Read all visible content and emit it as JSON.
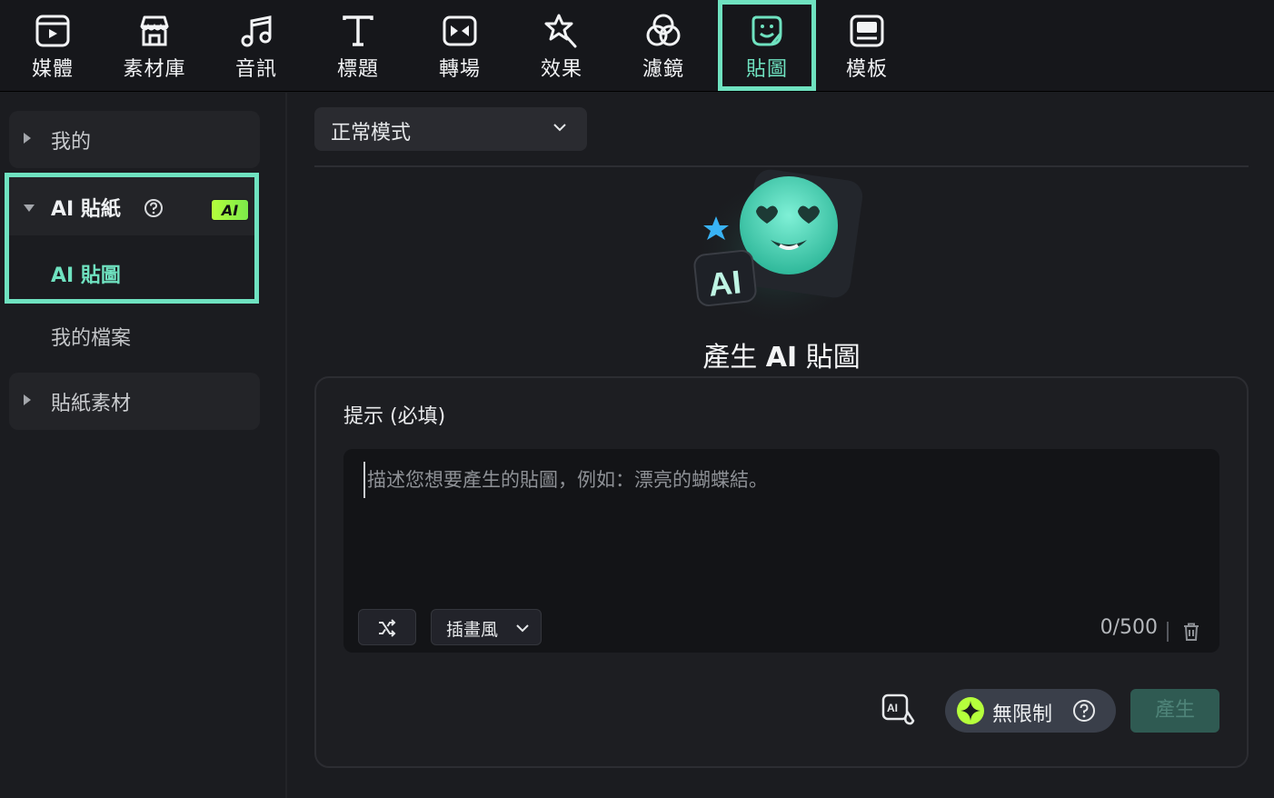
{
  "colors": {
    "accent": "#6fe2c0",
    "ai_badge": "#b5ff3c",
    "background": "#1b1c20"
  },
  "toolbar": {
    "tabs": [
      {
        "label": "媒體",
        "icon": "media-icon"
      },
      {
        "label": "素材庫",
        "icon": "store-icon"
      },
      {
        "label": "音訊",
        "icon": "music-note-icon"
      },
      {
        "label": "標題",
        "icon": "title-t-icon"
      },
      {
        "label": "轉場",
        "icon": "transition-icon"
      },
      {
        "label": "效果",
        "icon": "effects-star-icon"
      },
      {
        "label": "濾鏡",
        "icon": "filter-circles-icon"
      },
      {
        "label": "貼圖",
        "icon": "sticker-icon",
        "active": true
      },
      {
        "label": "模板",
        "icon": "template-icon"
      }
    ]
  },
  "sidebar": {
    "mine": "我的",
    "ai_sticker_group": "AI 貼紙",
    "ai_badge": "AI",
    "ai_sticker_item": "AI 貼圖",
    "my_files": "我的檔案",
    "sticker_assets": "貼紙素材"
  },
  "main": {
    "mode": "正常模式",
    "hero_title_prefix": "產生",
    "hero_title_ai": "AI",
    "hero_title_suffix": "貼圖",
    "hero_image_text": "AI",
    "prompt_label": "提示 (必填)",
    "prompt_placeholder": "描述您想要產生的貼圖，例如：漂亮的蝴蝶結。",
    "style": "插畫風",
    "counter": "0/500",
    "unlimited_label": "無限制",
    "generate_label": "產生"
  }
}
